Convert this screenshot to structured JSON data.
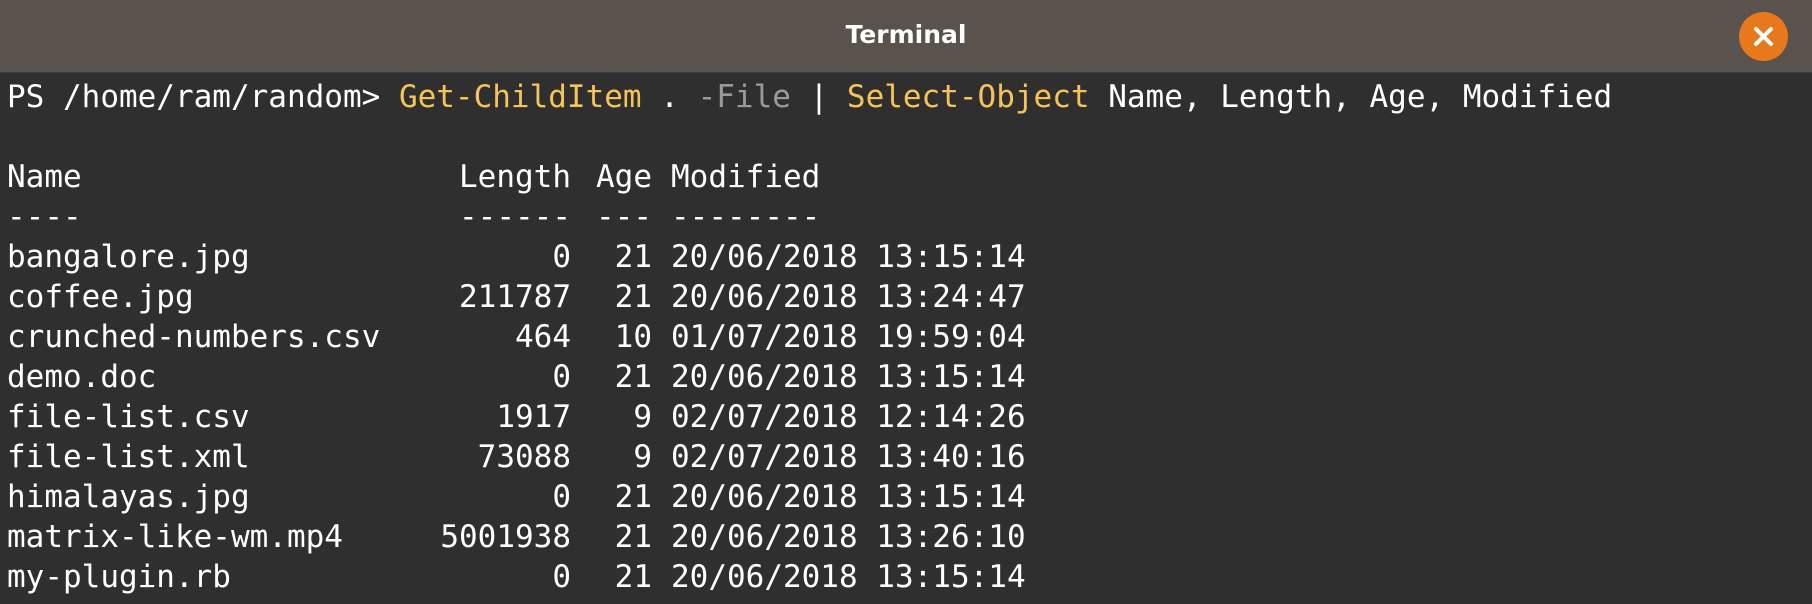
{
  "window": {
    "title": "Terminal",
    "close_icon": "close-icon",
    "accent_color": "#e7781c"
  },
  "prompt": {
    "text": "PS /home/ram/random> ",
    "command": "Get-ChildItem",
    "arg_dot": " . ",
    "flag": "-File",
    "pipe": " | ",
    "command2": "Select-Object",
    "args": " Name, Length, Age, Modified"
  },
  "table": {
    "headers": {
      "name": "Name",
      "length": "Length",
      "age": "Age",
      "modified": "Modified"
    },
    "underlines": {
      "name": "----",
      "length": "------",
      "age": "---",
      "modified": "--------"
    },
    "rows": [
      {
        "name": "bangalore.jpg",
        "length": "0",
        "age": "21",
        "modified": "20/06/2018 13:15:14"
      },
      {
        "name": "coffee.jpg",
        "length": "211787",
        "age": "21",
        "modified": "20/06/2018 13:24:47"
      },
      {
        "name": "crunched-numbers.csv",
        "length": "464",
        "age": "10",
        "modified": "01/07/2018 19:59:04"
      },
      {
        "name": "demo.doc",
        "length": "0",
        "age": "21",
        "modified": "20/06/2018 13:15:14"
      },
      {
        "name": "file-list.csv",
        "length": "1917",
        "age": "9",
        "modified": "02/07/2018 12:14:26"
      },
      {
        "name": "file-list.xml",
        "length": "73088",
        "age": "9",
        "modified": "02/07/2018 13:40:16"
      },
      {
        "name": "himalayas.jpg",
        "length": "0",
        "age": "21",
        "modified": "20/06/2018 13:15:14"
      },
      {
        "name": "matrix-like-wm.mp4",
        "length": "5001938",
        "age": "21",
        "modified": "20/06/2018 13:26:10"
      },
      {
        "name": "my-plugin.rb",
        "length": "0",
        "age": "21",
        "modified": "20/06/2018 13:15:14"
      }
    ]
  }
}
